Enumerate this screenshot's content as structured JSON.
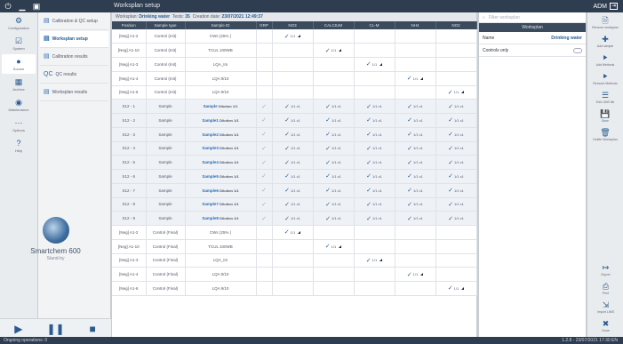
{
  "topbar": {
    "title": "Worksplan setup",
    "user": "ADM",
    "icons": [
      "power-icon",
      "minimize-icon",
      "window-icon"
    ]
  },
  "nav": [
    {
      "id": "configuration",
      "label": "Configuration",
      "icon": "gear-icon",
      "glyph": "⚙"
    },
    {
      "id": "system",
      "label": "System",
      "icon": "checklist-icon",
      "glyph": "☑"
    },
    {
      "id": "source",
      "label": "Source",
      "icon": "drop-icon",
      "glyph": "●"
    },
    {
      "id": "archive",
      "label": "Archive",
      "icon": "grid-icon",
      "glyph": "▦"
    },
    {
      "id": "maintenance",
      "label": "Maintenance",
      "icon": "globe-icon",
      "glyph": "◉"
    },
    {
      "id": "options",
      "label": "Options",
      "icon": "more-icon",
      "glyph": "⋯"
    },
    {
      "id": "help",
      "label": "Help",
      "icon": "help-icon",
      "glyph": "?"
    }
  ],
  "submenu": [
    {
      "label": "Calibration & QC setup",
      "icon": "settings-icon"
    },
    {
      "label": "Worksplan setup",
      "icon": "worksplan-icon"
    },
    {
      "label": "Calibration results",
      "icon": "calibration-icon"
    },
    {
      "label": "QC results",
      "icon": "qc-icon"
    },
    {
      "label": "Worksplan results",
      "icon": "results-icon"
    }
  ],
  "device": {
    "name": "Smartchem 600",
    "status": "Stand-by"
  },
  "controls": [
    "play-icon",
    "pause-icon",
    "stop-icon"
  ],
  "statusbar": {
    "left": "Ongoing operations: 0",
    "right": "1.2.8 - 23/07/2021 17:30 EN"
  },
  "infobar": {
    "worksplan_label": "Worksplan:",
    "worksplan_value": "Drinking water",
    "tests_label": "Tests:",
    "tests_value": "35",
    "date_label": "Creation date:",
    "date_value": "23/07/2021 12:49:37"
  },
  "table": {
    "headers": [
      "Position",
      "Sample type",
      "Sample ID",
      "GRP",
      "NO3",
      "CALCIUM",
      "CL-M",
      "NH4",
      "NO2"
    ],
    "rows": [
      {
        "pos": "[Neg] A1-2",
        "type": "Control (Init)",
        "sid": "CWs (25% )",
        "checks": [
          false,
          false,
          true,
          false,
          false,
          false
        ],
        "kind": "control"
      },
      {
        "pos": "[Neg] A1-10",
        "type": "Control (Init)",
        "sid": "TCUL 100WB",
        "checks": [
          false,
          false,
          false,
          true,
          false,
          false
        ],
        "kind": "control"
      },
      {
        "pos": "[Neg] A1-3",
        "type": "Control (Init)",
        "sid": "LQA_Im",
        "checks": [
          false,
          false,
          false,
          false,
          true,
          false
        ],
        "kind": "control"
      },
      {
        "pos": "[Neg] A1-4",
        "type": "Control (Init)",
        "sid": "LQA 9/10",
        "checks": [
          false,
          false,
          false,
          false,
          false,
          true
        ],
        "kind": "control"
      },
      {
        "pos": "[Neg] A1-6",
        "type": "Control (Init)",
        "sid": "LQA 9/10",
        "checks": [
          false,
          false,
          false,
          false,
          false,
          false,
          true
        ],
        "kind": "control"
      },
      {
        "pos": "S12 - 1",
        "type": "Sample",
        "sid": "Sample",
        "dil": "Dilution 1/1",
        "checks": [
          true,
          true,
          true,
          true,
          true,
          true
        ],
        "kind": "sample"
      },
      {
        "pos": "S12 - 2",
        "type": "Sample",
        "sid": "Sample1",
        "dil": "Dilution 1/1",
        "checks": [
          true,
          true,
          true,
          true,
          true,
          true
        ],
        "kind": "sample"
      },
      {
        "pos": "S12 - 3",
        "type": "Sample",
        "sid": "Sample2",
        "dil": "Dilution 1/1",
        "checks": [
          true,
          true,
          true,
          true,
          true,
          true
        ],
        "kind": "sample"
      },
      {
        "pos": "S12 - 4",
        "type": "Sample",
        "sid": "Sample3",
        "dil": "Dilution 1/1",
        "checks": [
          true,
          true,
          true,
          true,
          true,
          true
        ],
        "kind": "sample"
      },
      {
        "pos": "S12 - 5",
        "type": "Sample",
        "sid": "Sample4",
        "dil": "Dilution 1/1",
        "checks": [
          true,
          true,
          true,
          true,
          true,
          true
        ],
        "kind": "sample"
      },
      {
        "pos": "S12 - 6",
        "type": "Sample",
        "sid": "Sample5",
        "dil": "Dilution 1/1",
        "checks": [
          true,
          true,
          true,
          true,
          true,
          true
        ],
        "kind": "sample"
      },
      {
        "pos": "S12 - 7",
        "type": "Sample",
        "sid": "Sample6",
        "dil": "Dilution 1/1",
        "checks": [
          true,
          true,
          true,
          true,
          true,
          true
        ],
        "kind": "sample"
      },
      {
        "pos": "S12 - 8",
        "type": "Sample",
        "sid": "Sample7",
        "dil": "Dilution 1/1",
        "checks": [
          true,
          true,
          true,
          true,
          true,
          true
        ],
        "kind": "sample"
      },
      {
        "pos": "S12 - 9",
        "type": "Sample",
        "sid": "Sample8",
        "dil": "Dilution 1/1",
        "checks": [
          true,
          true,
          true,
          true,
          true,
          true
        ],
        "kind": "sample"
      },
      {
        "pos": "[Neg] A1-2",
        "type": "Control (Final)",
        "sid": "CWs (25% )",
        "checks": [
          false,
          false,
          true,
          false,
          false,
          false
        ],
        "kind": "control"
      },
      {
        "pos": "[Neg] A1-10",
        "type": "Control (Final)",
        "sid": "TCUL 100WB",
        "checks": [
          false,
          false,
          false,
          true,
          false,
          false
        ],
        "kind": "control"
      },
      {
        "pos": "[Neg] A1-3",
        "type": "Control (Final)",
        "sid": "LQA_Im",
        "checks": [
          false,
          false,
          false,
          false,
          true,
          false
        ],
        "kind": "control"
      },
      {
        "pos": "[Neg] A1-4",
        "type": "Control (Final)",
        "sid": "LQA 9/10",
        "checks": [
          false,
          false,
          false,
          false,
          false,
          true
        ],
        "kind": "control"
      },
      {
        "pos": "[Neg] A1-6",
        "type": "Control (Final)",
        "sid": "LQA 9/10",
        "checks": [
          false,
          false,
          false,
          false,
          false,
          false,
          true
        ],
        "kind": "control"
      }
    ],
    "check_text": "1/1",
    "x_text": "x1"
  },
  "panel": {
    "search_placeholder": "Filter worksplan",
    "header": "Worksplan",
    "rows": [
      {
        "label": "Name",
        "value": "Drinking water"
      },
      {
        "label": "Controls only",
        "value": ""
      }
    ]
  },
  "toolbar": {
    "top": [
      {
        "label": "Remove worksplan",
        "icon": "remove-doc-icon",
        "glyph": "🗎"
      },
      {
        "label": "Add sample",
        "icon": "plus-icon",
        "glyph": "✚"
      },
      {
        "label": "Add Methods",
        "icon": "add-method-icon",
        "glyph": "⯈"
      },
      {
        "label": "Remove Methods",
        "icon": "remove-method-icon",
        "glyph": "⯈"
      },
      {
        "label": "Edit LIMS file",
        "icon": "list-icon",
        "glyph": "☰"
      },
      {
        "label": "Save",
        "icon": "save-icon",
        "glyph": "💾"
      },
      {
        "label": "Delete Worksplan",
        "icon": "trash-icon",
        "glyph": "🗑"
      }
    ],
    "bottom": [
      {
        "label": "Export",
        "icon": "export-icon",
        "glyph": "↦"
      },
      {
        "label": "Print",
        "icon": "print-icon",
        "glyph": "⎙"
      },
      {
        "label": "Import LIMS",
        "icon": "import-icon",
        "glyph": "⇲"
      },
      {
        "label": "Close",
        "icon": "close-icon",
        "glyph": "✖"
      }
    ]
  }
}
